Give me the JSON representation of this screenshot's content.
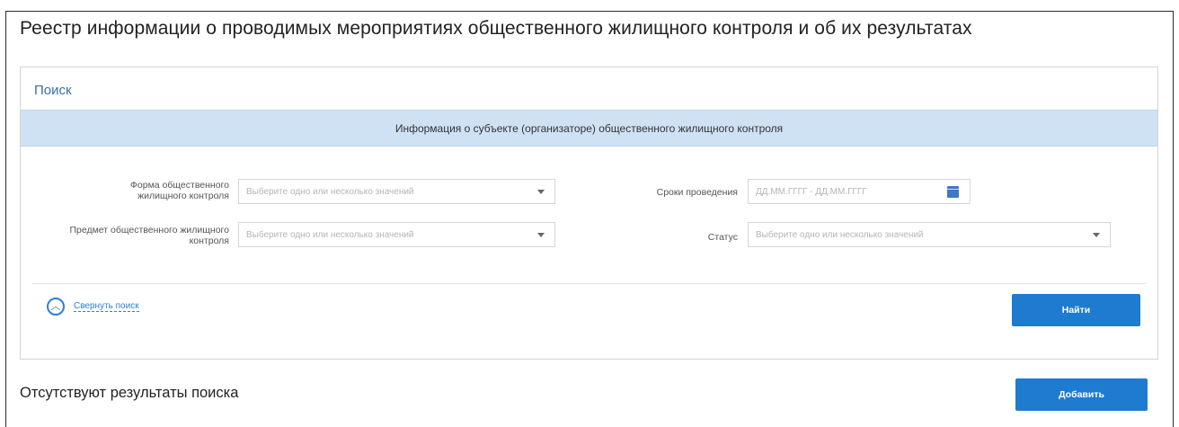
{
  "header": {
    "title": "Реестр информации о проводимых мероприятиях общественного жилищного контроля и об их результатах"
  },
  "search": {
    "panel_title": "Поиск",
    "section_title": "Информация о субъекте (организаторе) общественного жилищного контроля",
    "fields": {
      "form": {
        "label": "Форма общественного жилищного контроля",
        "placeholder": "Выберите одно или несколько значений"
      },
      "subject": {
        "label": "Предмет общественного жилищного контроля",
        "placeholder": "Выберите одно или несколько значений"
      },
      "dates": {
        "label": "Сроки проведения",
        "placeholder": "ДД.ММ.ГГГГ - ДД.ММ.ГГГГ"
      },
      "status": {
        "label": "Статус",
        "placeholder": "Выберите одно или несколько значений"
      }
    },
    "collapse_label": "Свернуть поиск",
    "find_button": "Найти"
  },
  "results": {
    "empty_text": "Отсутствуют результаты поиска",
    "add_button": "Добавить"
  },
  "colors": {
    "accent": "#1e7bd0",
    "section_band": "#cfe2f3",
    "link": "#3a6ea5"
  },
  "icons": {
    "dropdown": "chevron-down-icon",
    "calendar": "calendar-icon",
    "collapse": "collapse-up-icon"
  }
}
